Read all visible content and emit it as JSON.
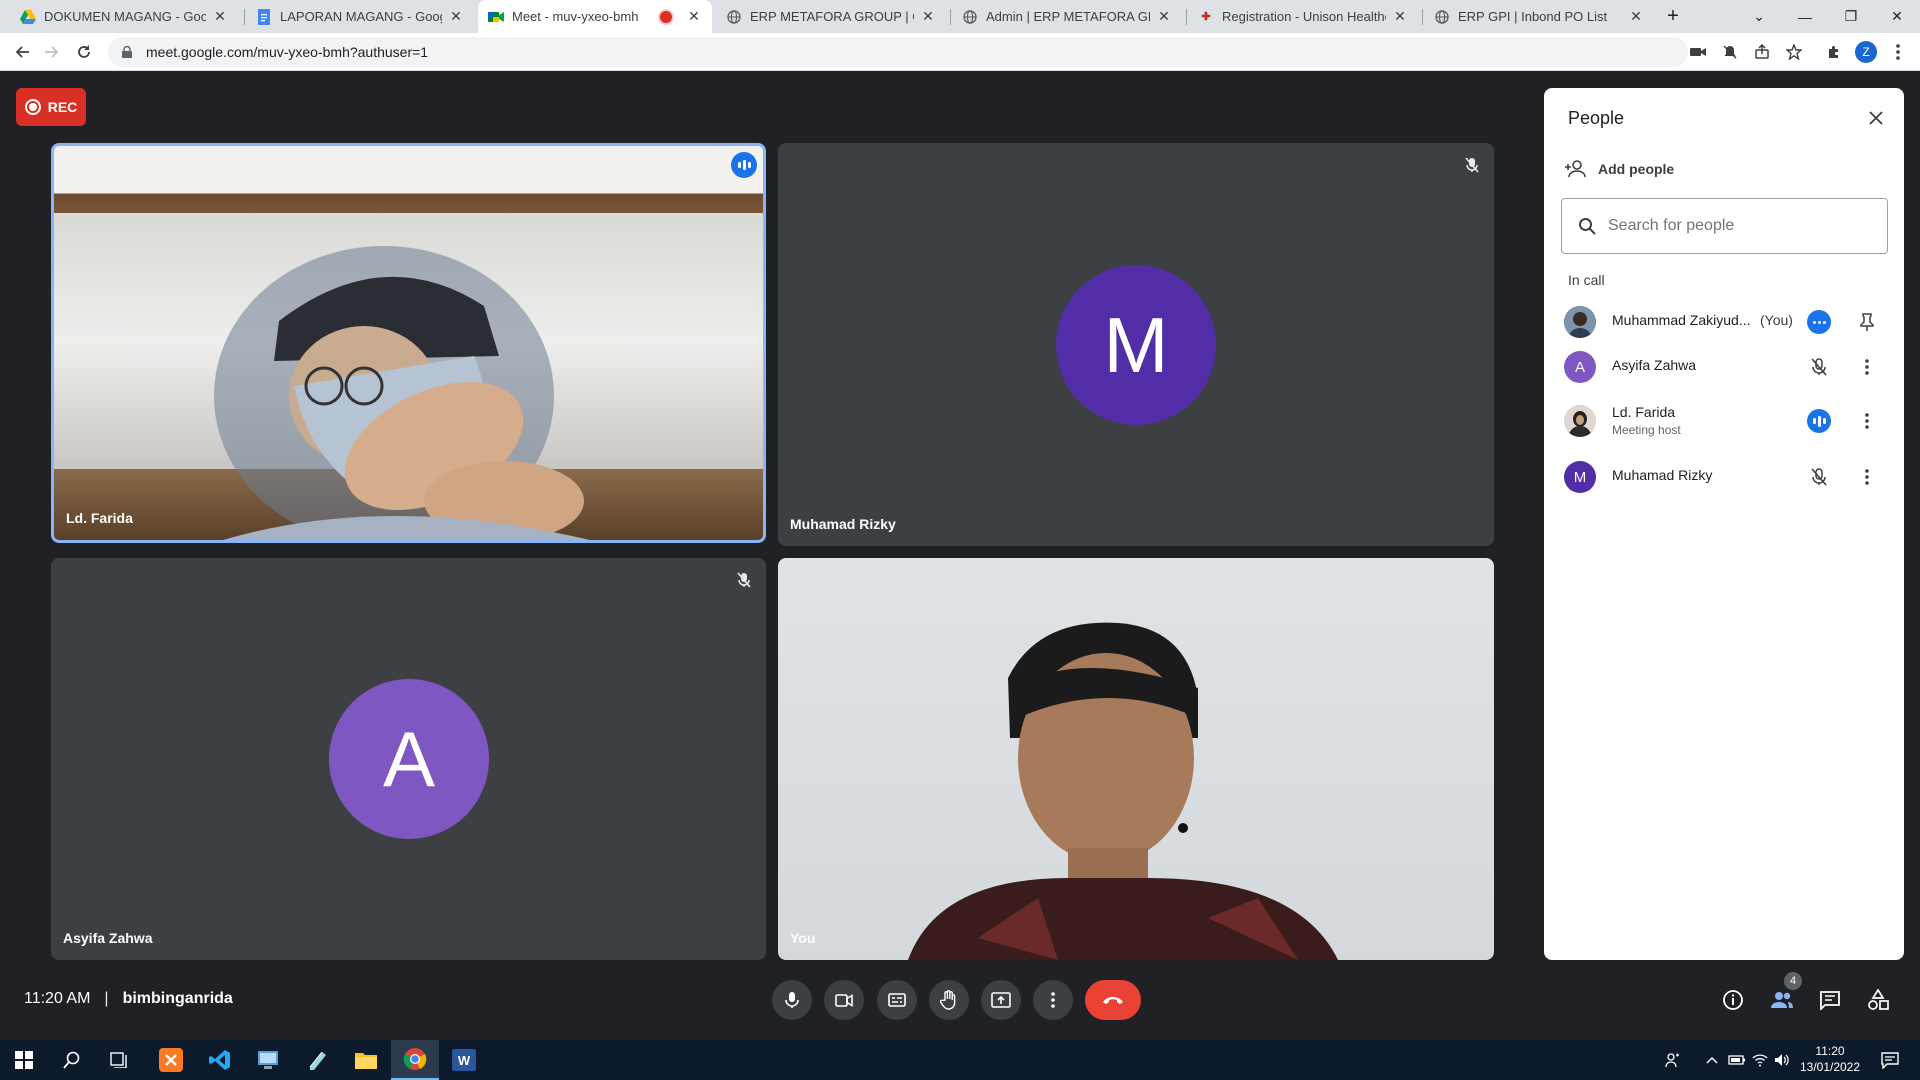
{
  "browser": {
    "tabs": [
      {
        "title": "DOKUMEN MAGANG - Google D",
        "icon": "google-drive-icon"
      },
      {
        "title": "LAPORAN MAGANG - Google Do",
        "icon": "google-docs-icon"
      },
      {
        "title": "Meet - muv-yxeo-bmh",
        "icon": "google-meet-icon",
        "active": true
      },
      {
        "title": "ERP METAFORA GROUP | Op Da",
        "icon": "globe-icon"
      },
      {
        "title": "Admin | ERP METAFORA GROUP",
        "icon": "globe-icon"
      },
      {
        "title": "Registration - Unison Healthcare",
        "icon": "unison-icon"
      },
      {
        "title": "ERP GPI | Inbond PO List",
        "icon": "globe-icon"
      }
    ],
    "new_tab": "+",
    "url": "meet.google.com/muv-yxeo-bmh?authuser=1",
    "profile_initial": "Z"
  },
  "meet": {
    "rec_label": "REC",
    "tiles": [
      {
        "name": "Ld. Farida",
        "type": "video",
        "speaking": true
      },
      {
        "name": "Muhamad Rizky",
        "type": "avatar",
        "initial": "M",
        "color": "#512da8",
        "muted": true
      },
      {
        "name": "Asyifa Zahwa",
        "type": "avatar",
        "initial": "A",
        "color": "#7e57c2",
        "muted": true
      },
      {
        "name": "You",
        "type": "video"
      }
    ],
    "time": "11:20 AM",
    "separator": "|",
    "meeting_code": "bimbinganrida",
    "participant_count": "4"
  },
  "people_panel": {
    "title": "People",
    "add_people": "Add people",
    "search_placeholder": "Search for people",
    "section": "In call",
    "participants": [
      {
        "name": "Muhammad Zakiyud...",
        "you_label": "(You)",
        "initial": "",
        "color": "#4a6d8c"
      },
      {
        "name": "Asyifa Zahwa",
        "initial": "A",
        "color": "#7e57c2"
      },
      {
        "name": "Ld. Farida",
        "subtitle": "Meeting host",
        "initial": "",
        "color": "#8d6e63"
      },
      {
        "name": "Muhamad Rizky",
        "initial": "M",
        "color": "#512da8"
      }
    ]
  },
  "taskbar": {
    "time": "11:20",
    "date": "13/01/2022"
  }
}
